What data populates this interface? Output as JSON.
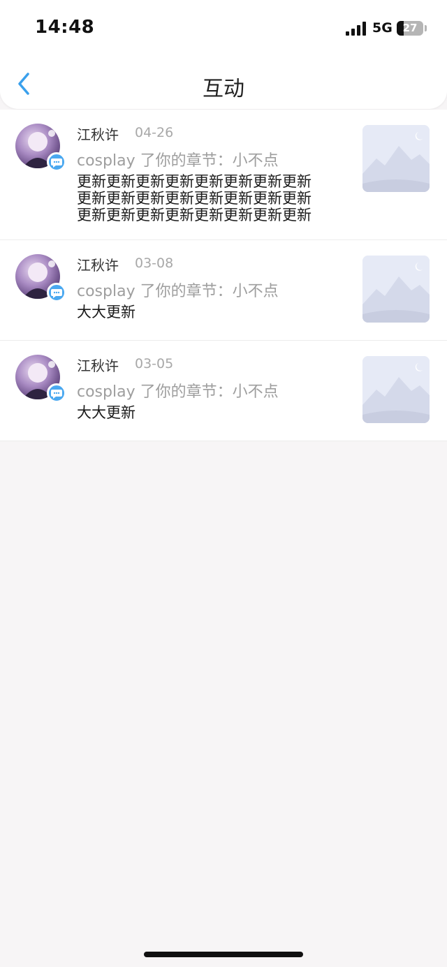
{
  "status_bar": {
    "time": "14:48",
    "network": "5G",
    "battery": "27"
  },
  "nav": {
    "title": "互动"
  },
  "items": [
    {
      "name": "江秋许",
      "date": "04-26",
      "action": "cosplay 了你的章节：小不点",
      "content": "更新更新更新更新更新更新更新更新更新更新更新更新更新更新更新更新更新更新更新更新更新更新更新更新更新更新…"
    },
    {
      "name": "江秋许",
      "date": "03-08",
      "action": "cosplay 了你的章节：小不点",
      "content": "大大更新"
    },
    {
      "name": "江秋许",
      "date": "03-05",
      "action": "cosplay 了你的章节：小不点",
      "content": "大大更新"
    }
  ],
  "colors": {
    "accent": "#4aa8f0",
    "background": "#f7f5f6"
  }
}
